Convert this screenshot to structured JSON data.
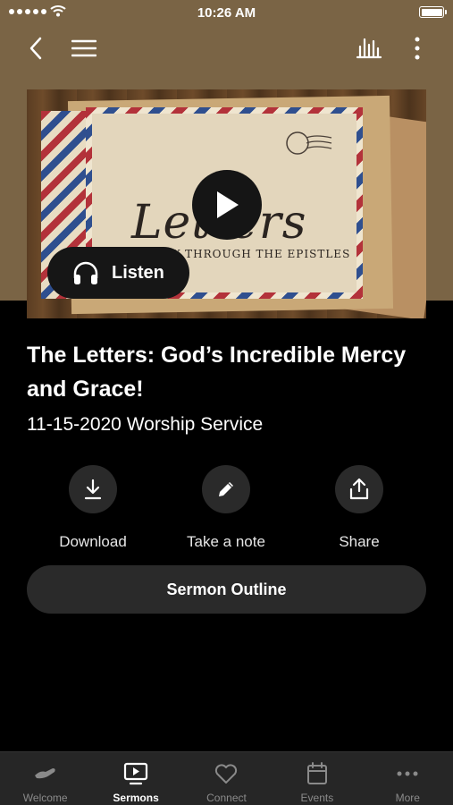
{
  "status_bar": {
    "time": "10:26 AM"
  },
  "sermon": {
    "artwork": {
      "title": "Letters",
      "subtitle": "A STUDY THROUGH THE EPISTLES"
    },
    "listen_label": "Listen",
    "title": "The Letters: God’s Incredible Mercy and Grace!",
    "subtitle": "11-15-2020 Worship Service"
  },
  "actions": {
    "download": "Download",
    "note": "Take a note",
    "share": "Share"
  },
  "outline_button": "Sermon Outline",
  "tabs": [
    {
      "label": "Welcome",
      "icon": "welcome-icon",
      "active": false
    },
    {
      "label": "Sermons",
      "icon": "sermons-icon",
      "active": true
    },
    {
      "label": "Connect",
      "icon": "heart-icon",
      "active": false
    },
    {
      "label": "Events",
      "icon": "calendar-icon",
      "active": false
    },
    {
      "label": "More",
      "icon": "more-icon",
      "active": false
    }
  ],
  "colors": {
    "header_bg": "#7a6445",
    "surface": "#2a2a2a",
    "tab_bg": "#262626",
    "inactive_tab": "#8a8a8a"
  }
}
